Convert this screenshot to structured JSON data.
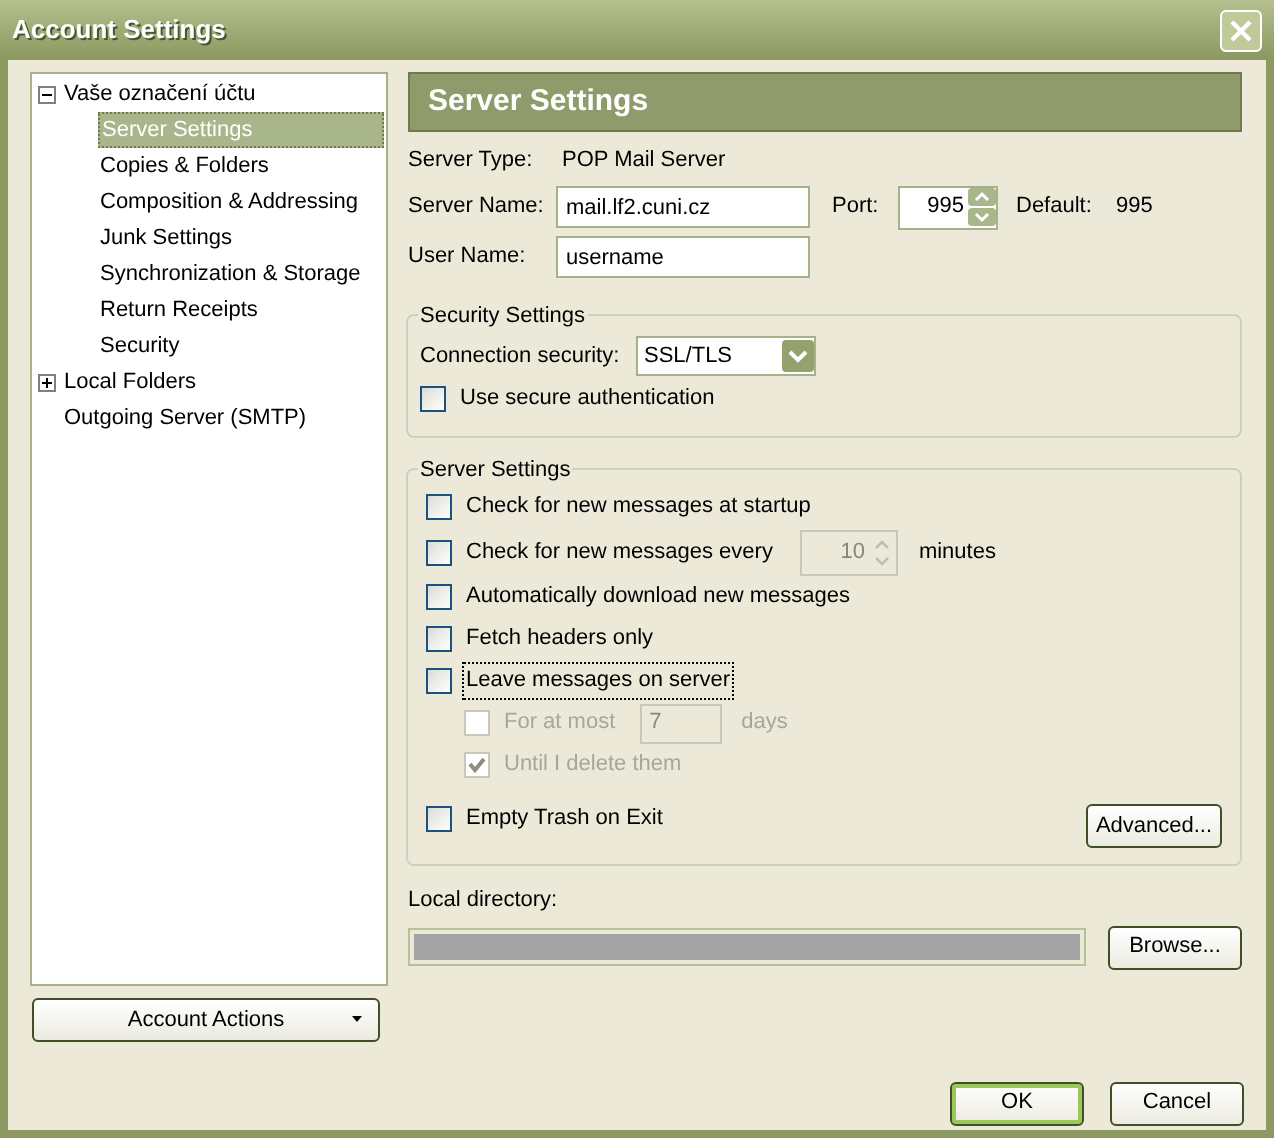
{
  "window": {
    "title": "Account Settings"
  },
  "tree": [
    {
      "label": "Vaše označení účtu",
      "expanded": true,
      "selected": false,
      "children": [
        {
          "label": "Server Settings",
          "selected": true
        },
        {
          "label": "Copies & Folders",
          "selected": false
        },
        {
          "label": "Composition & Addressing",
          "selected": false
        },
        {
          "label": "Junk Settings",
          "selected": false
        },
        {
          "label": "Synchronization & Storage",
          "selected": false
        },
        {
          "label": "Return Receipts",
          "selected": false
        },
        {
          "label": "Security",
          "selected": false
        }
      ]
    },
    {
      "label": "Local Folders",
      "expanded": false,
      "selected": false
    },
    {
      "label": "Outgoing Server (SMTP)",
      "selected": false
    }
  ],
  "account_actions": {
    "label": "Account Actions"
  },
  "panel_title": "Server Settings",
  "server_type": {
    "label": "Server Type:",
    "value": "POP Mail Server"
  },
  "server_name": {
    "label": "Server Name:",
    "value": "mail.lf2.cuni.cz"
  },
  "port": {
    "label": "Port:",
    "value": "995"
  },
  "default_port": {
    "label": "Default:",
    "value": "995"
  },
  "user_name": {
    "label": "User Name:",
    "value": "username"
  },
  "security_group": {
    "title": "Security Settings",
    "connection_label": "Connection security:",
    "connection_value": "SSL/TLS",
    "options": [
      {
        "label": "Use secure authentication",
        "checked": false
      }
    ]
  },
  "server_group": {
    "title": "Server Settings",
    "advanced": "Advanced...",
    "options": [
      {
        "kind": "check",
        "label": "Check for new messages at startup",
        "checked": false,
        "disabled": false
      },
      {
        "kind": "spinner",
        "label": "Check for new messages every",
        "value": "10",
        "suffix": "minutes",
        "checked": false,
        "disabled": false
      },
      {
        "kind": "check",
        "label": "Automatically download new messages",
        "checked": false,
        "disabled": false
      },
      {
        "kind": "check",
        "label": "Fetch headers only",
        "checked": false,
        "disabled": false
      },
      {
        "kind": "check",
        "label": "Leave messages on server",
        "checked": false,
        "disabled": false,
        "focused": true,
        "children": [
          {
            "kind": "field",
            "label": "For at most",
            "value": "7",
            "suffix": "days",
            "checked": false,
            "disabled": true
          },
          {
            "kind": "check",
            "label": "Until I delete them",
            "checked": true,
            "disabled": true
          }
        ]
      },
      {
        "kind": "check",
        "label": "Empty Trash on Exit",
        "checked": false,
        "disabled": false
      }
    ]
  },
  "local_directory": {
    "label": "Local directory:",
    "disabled": true,
    "browse": "Browse..."
  },
  "buttons": [
    {
      "label": "OK",
      "default": true
    },
    {
      "label": "Cancel",
      "default": false
    }
  ]
}
